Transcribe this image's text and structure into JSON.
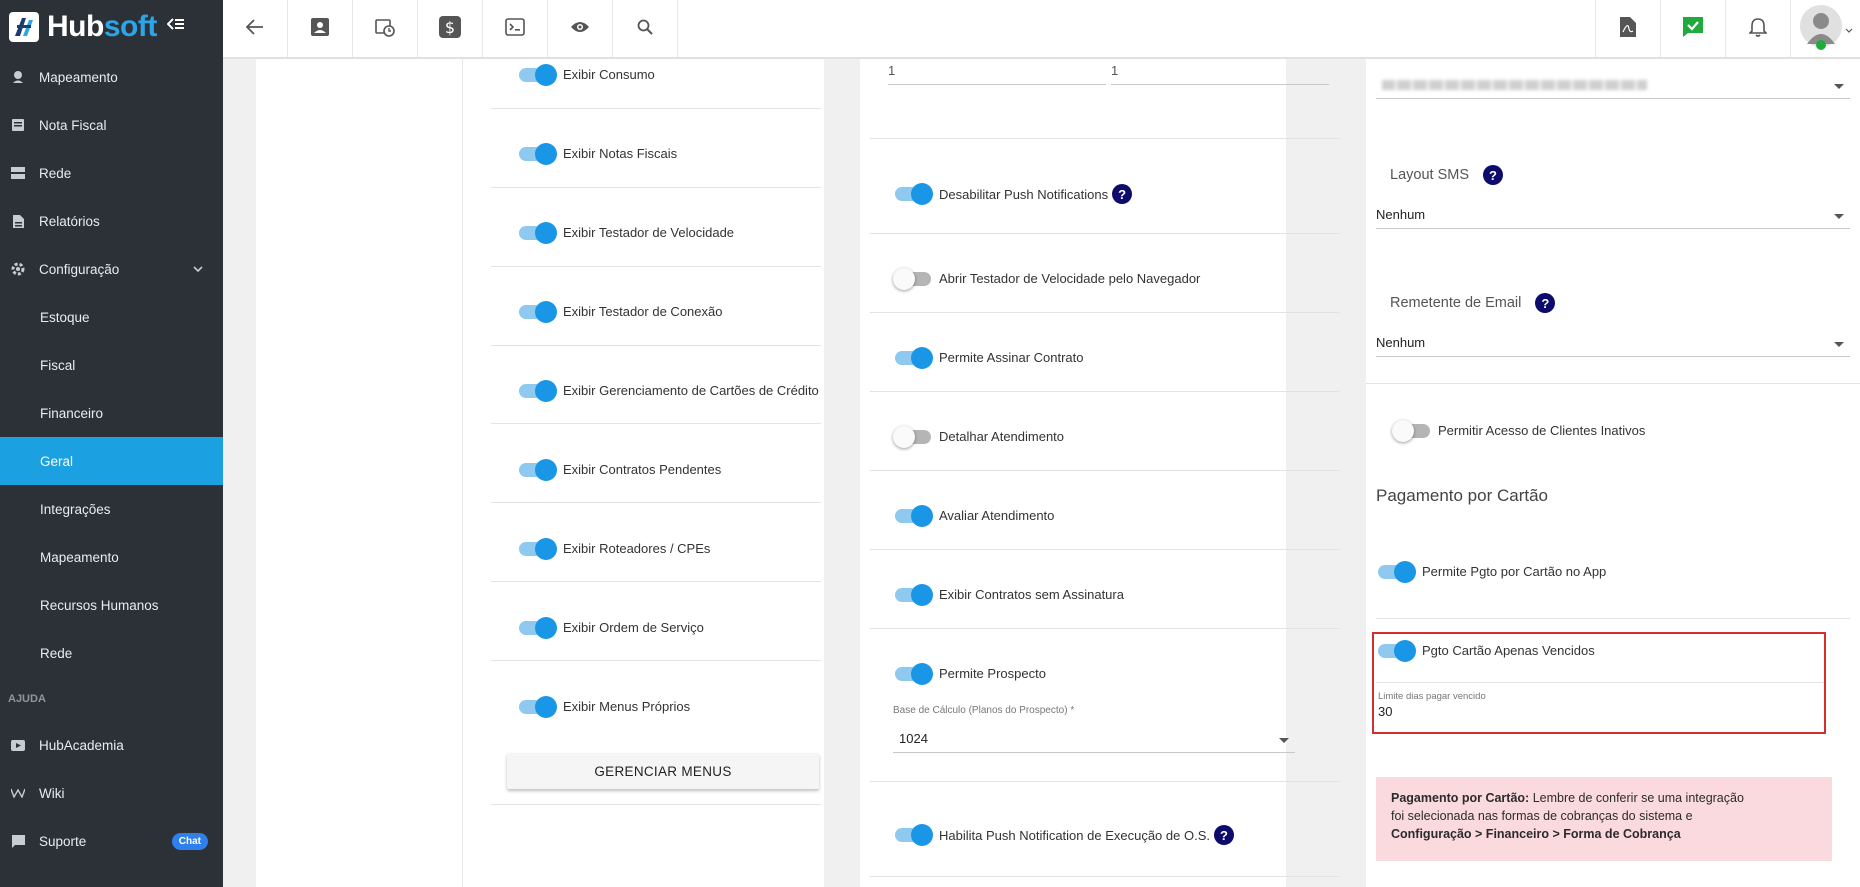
{
  "brand": {
    "name_part1": "Hub",
    "name_part2": "soft",
    "accent": "#1ba1e2"
  },
  "sidebar": {
    "items": [
      {
        "label": "Mapeamento",
        "icon": "map-pin-icon"
      },
      {
        "label": "Nota Fiscal",
        "icon": "receipt-icon"
      },
      {
        "label": "Rede",
        "icon": "server-icon"
      },
      {
        "label": "Relatórios",
        "icon": "report-icon"
      },
      {
        "label": "Configuração",
        "icon": "gear-icon"
      }
    ],
    "sub_items": [
      "Estoque",
      "Fiscal",
      "Financeiro",
      "Geral",
      "Integrações",
      "Mapeamento",
      "Recursos Humanos",
      "Rede"
    ],
    "active_sub": "Geral",
    "help_group": "AJUDA",
    "help_items": [
      {
        "label": "HubAcademia",
        "icon": "video-icon"
      },
      {
        "label": "Wiki",
        "icon": "wiki-icon"
      },
      {
        "label": "Suporte",
        "icon": "chat-icon",
        "badge": "Chat"
      }
    ]
  },
  "topbar": {
    "left_icons": [
      "back-arrow-icon",
      "contact-card-icon",
      "calendar-clock-icon",
      "dollar-icon",
      "terminal-icon",
      "eye-icon",
      "search-icon"
    ],
    "right_icons": [
      "pdf-icon",
      "chat-check-icon",
      "bell-icon",
      "user-avatar-icon"
    ]
  },
  "col1": {
    "toggles": [
      {
        "label": "Exibir Consumo",
        "on": true
      },
      {
        "label": "Exibir Notas Fiscais",
        "on": true
      },
      {
        "label": "Exibir Testador de Velocidade",
        "on": true
      },
      {
        "label": "Exibir Testador de Conexão",
        "on": true
      },
      {
        "label": "Exibir Gerenciamento de Cartões de Crédito",
        "on": true
      },
      {
        "label": "Exibir Contratos Pendentes",
        "on": true
      },
      {
        "label": "Exibir Roteadores / CPEs",
        "on": true
      },
      {
        "label": "Exibir Ordem de Serviço",
        "on": true
      },
      {
        "label": "Exibir Menus Próprios",
        "on": true
      }
    ],
    "manage_button": "GERENCIAR MENUS"
  },
  "col2": {
    "top_values": [
      "1",
      "1"
    ],
    "toggles": [
      {
        "label": "Desabilitar Push Notifications",
        "on": true,
        "help": true
      },
      {
        "label": "Abrir Testador de Velocidade pelo Navegador",
        "on": false
      },
      {
        "label": "Permite Assinar Contrato",
        "on": true
      },
      {
        "label": "Detalhar Atendimento",
        "on": false
      },
      {
        "label": "Avaliar Atendimento",
        "on": true
      },
      {
        "label": "Exibir Contratos sem Assinatura",
        "on": true
      },
      {
        "label": "Permite Prospecto",
        "on": true
      }
    ],
    "base_calc_label": "Base de Cálculo (Planos do Prospecto) *",
    "base_calc_value": "1024",
    "push_os_label": "Habilita Push Notification de Execução de O.S."
  },
  "col3": {
    "layout_sms_label": "Layout SMS",
    "layout_sms_value": "Nenhum",
    "remetente_label": "Remetente de Email",
    "remetente_value": "Nenhum",
    "inactive_clients_label": "Permitir Acesso de Clientes Inativos",
    "card_section_title": "Pagamento por Cartão",
    "card_app_label": "Permite Pgto por Cartão no App",
    "card_overdue_label": "Pgto Cartão Apenas Vencidos",
    "limit_label": "Limite dias pagar vencido",
    "limit_value": "30",
    "alert": {
      "bold_prefix": "Pagamento por Cartão:",
      "text_line1": " Lembre de conferir se uma integração",
      "text_line2": "foi selecionada nas formas de cobranças do sistema e",
      "bold_path": "Configuração > Financeiro > Forma de Cobrança"
    }
  }
}
